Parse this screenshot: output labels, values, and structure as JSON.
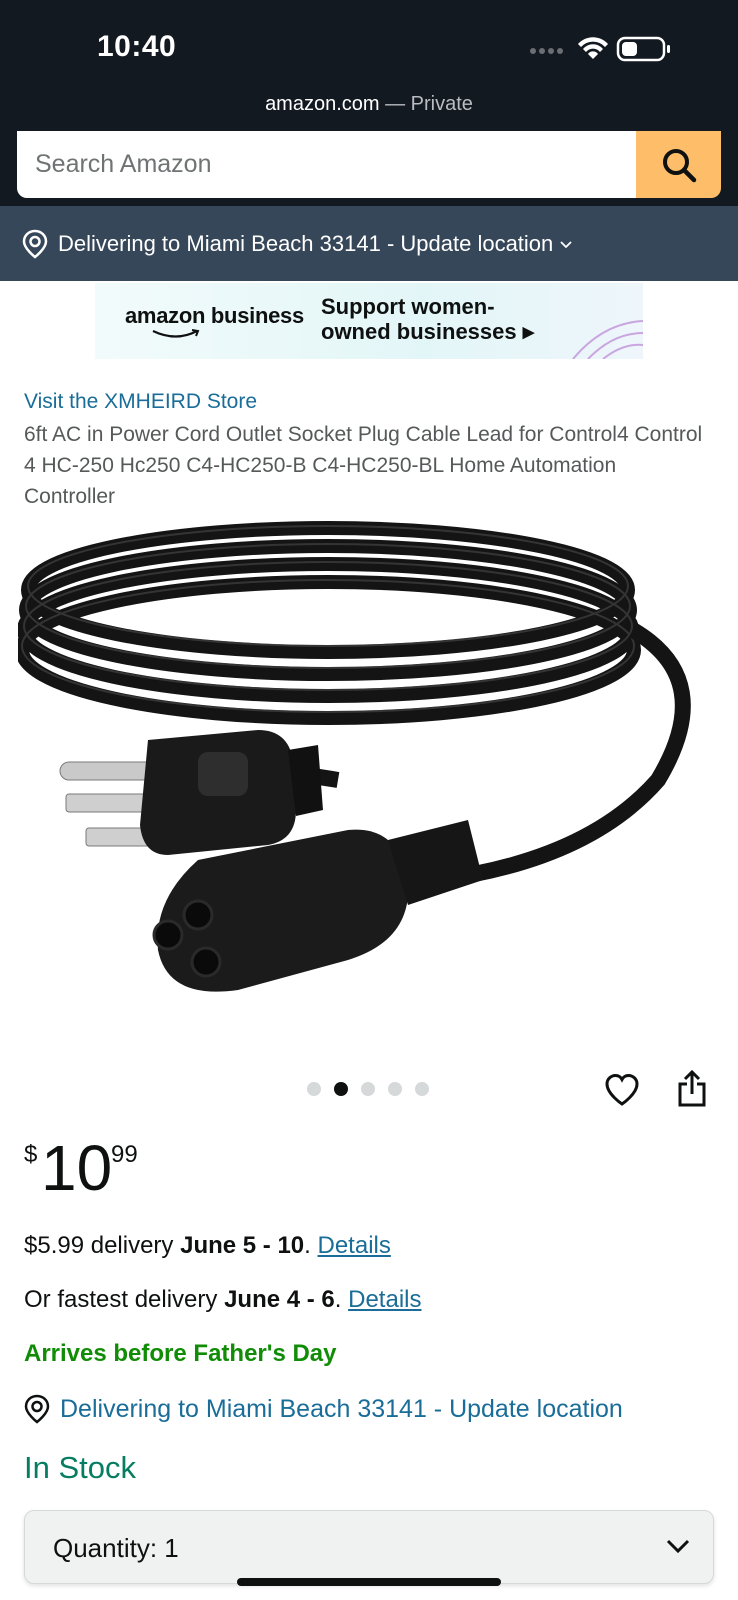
{
  "status_bar": {
    "time": "10:40"
  },
  "browser": {
    "domain": "amazon.com",
    "mode": "— Private"
  },
  "search": {
    "placeholder": "Search Amazon"
  },
  "location_bar": {
    "text": "Delivering to Miami Beach 33141 - Update location"
  },
  "banner": {
    "brand": "amazon business",
    "headline_line1": "Support women-",
    "headline_line2": "owned businesses"
  },
  "product": {
    "store_link": "Visit the XMHEIRD Store",
    "title": "6ft AC in Power Cord Outlet Socket Plug Cable Lead for Control4 Control 4 HC-250 Hc250 C4-HC250-B C4-HC250-BL Home Automation Controller",
    "image_count": 5,
    "active_image": 2
  },
  "price": {
    "symbol": "$",
    "whole": "10",
    "fraction": "99"
  },
  "delivery": {
    "standard_prefix": "$5.99 delivery ",
    "standard_dates": "June 5 - 10",
    "standard_suffix": ". ",
    "fastest_prefix": "Or fastest delivery ",
    "fastest_dates": "June 4 - 6",
    "fastest_suffix": ". ",
    "details_label": "Details",
    "promo": "Arrives before Father's Day",
    "location": "Delivering to Miami Beach 33141 - Update location"
  },
  "availability": "In Stock",
  "quantity": {
    "label": "Quantity:",
    "value": "1"
  },
  "colors": {
    "header": "#131921",
    "location_bar": "#37475a",
    "search_button": "#febd69",
    "link": "#1a6d98",
    "in_stock": "#067d62",
    "promo": "#118c06"
  }
}
